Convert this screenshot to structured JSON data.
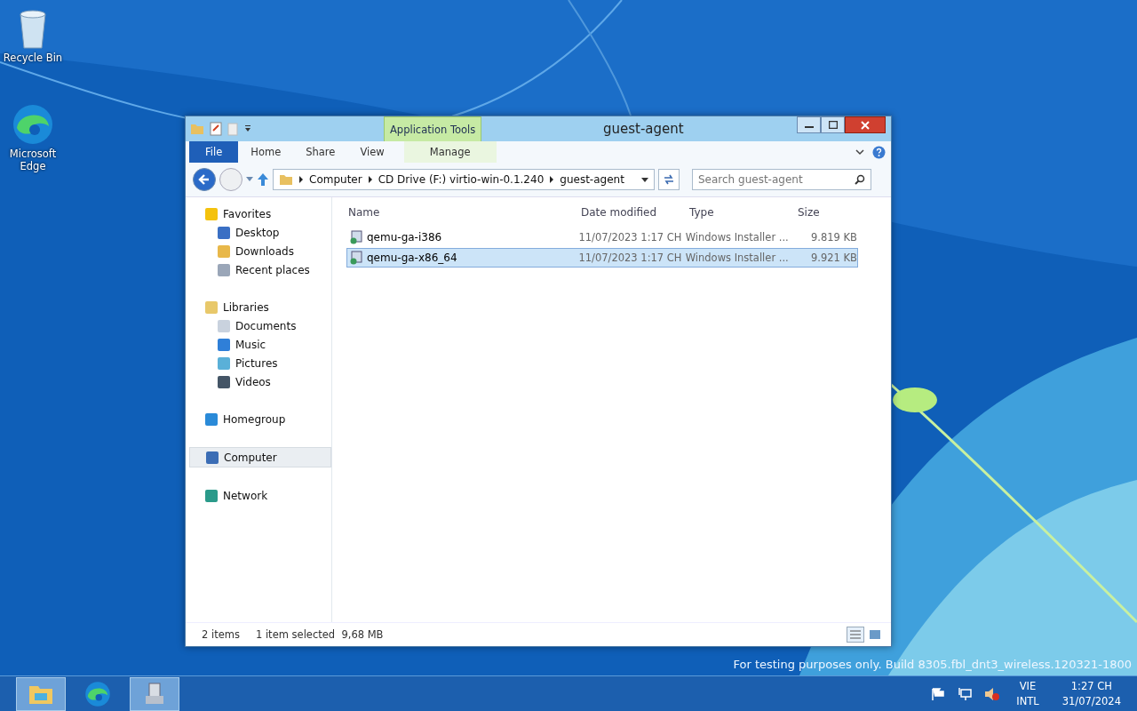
{
  "desktop_icons": [
    {
      "label": "Recycle Bin",
      "kind": "bin"
    },
    {
      "label": "Microsoft Edge",
      "kind": "edge"
    }
  ],
  "window": {
    "title": "guest-agent",
    "context_tab_group": "Application Tools",
    "ribbon_tabs": [
      {
        "label": "File",
        "kind": "file",
        "selected": false
      },
      {
        "label": "Home",
        "kind": "tab",
        "selected": false
      },
      {
        "label": "Share",
        "kind": "tab",
        "selected": false
      },
      {
        "label": "View",
        "kind": "tab",
        "selected": false
      },
      {
        "label": "Manage",
        "kind": "context",
        "selected": false
      }
    ],
    "address": [
      "Computer",
      "CD Drive (F:) virtio-win-0.1.240",
      "guest-agent"
    ],
    "search": {
      "placeholder": "Search guest-agent"
    },
    "sidebar": [
      {
        "label": "Favorites",
        "selected": false,
        "children": [
          {
            "label": "Desktop",
            "selected": false
          },
          {
            "label": "Downloads",
            "selected": false
          },
          {
            "label": "Recent places",
            "selected": false
          }
        ]
      },
      {
        "label": "Libraries",
        "selected": false,
        "children": [
          {
            "label": "Documents",
            "selected": false
          },
          {
            "label": "Music",
            "selected": false
          },
          {
            "label": "Pictures",
            "selected": false
          },
          {
            "label": "Videos",
            "selected": false
          }
        ]
      },
      {
        "label": "Homegroup",
        "selected": false
      },
      {
        "label": "Computer",
        "selected": true
      },
      {
        "label": "Network",
        "selected": false
      }
    ],
    "columns": [
      "Name",
      "Date modified",
      "Type",
      "Size"
    ],
    "rows": [
      {
        "name": "qemu-ga-i386",
        "date": "11/07/2023 1:17 CH",
        "type": "Windows Installer ...",
        "size": "9.819 KB",
        "selected": false
      },
      {
        "name": "qemu-ga-x86_64",
        "date": "11/07/2023 1:17 CH",
        "type": "Windows Installer ...",
        "size": "9.921 KB",
        "selected": true
      }
    ],
    "status_bar": [
      "2 items",
      "1 item selected  9,68 MB"
    ]
  },
  "build_text": "For testing purposes only. Build 8305.fbl_dnt3_wireless.120321-1800",
  "taskbar": {
    "apps": [
      {
        "kind": "explorer",
        "selected": true
      },
      {
        "kind": "edge",
        "selected": false
      },
      {
        "kind": "installer",
        "selected": true
      }
    ],
    "language": [
      "VIE",
      "INTL"
    ],
    "time": "1:27 CH",
    "date": "31/07/2024"
  }
}
